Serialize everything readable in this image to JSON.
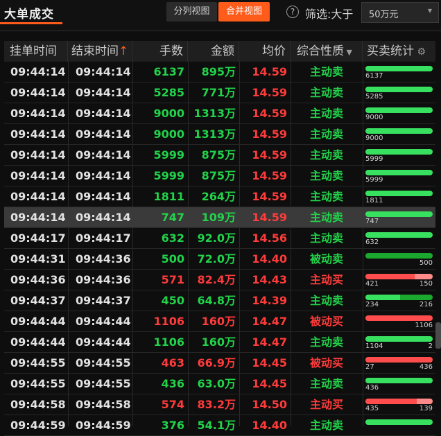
{
  "title": "大单成交",
  "view_toggle": {
    "split": "分列视图",
    "merge": "合并视图"
  },
  "filter": {
    "label": "筛选:大于",
    "value": "50万元"
  },
  "columns": [
    "挂单时间",
    "结束时间",
    "手数",
    "金额",
    "均价",
    "综合性质",
    "买卖统计"
  ],
  "colors": {
    "accent": "#ff5b1a",
    "up": "#ff3b3b",
    "down": "#22d34a",
    "buy_bar": "#38e060",
    "passive_sell_bar": "#1aa82e",
    "sell_bar": "#ff4d4d"
  },
  "rows": [
    {
      "start": "09:44:14",
      "end": "09:44:14",
      "vol": "6137",
      "amt": "895万",
      "avg": "14.59",
      "type": "主动卖",
      "dir": "dn",
      "bar": {
        "kind": "buy",
        "ratio": 1,
        "left": "6137",
        "right": ""
      }
    },
    {
      "start": "09:44:14",
      "end": "09:44:14",
      "vol": "5285",
      "amt": "771万",
      "avg": "14.59",
      "type": "主动卖",
      "dir": "dn",
      "bar": {
        "kind": "buy",
        "ratio": 1,
        "left": "5285",
        "right": ""
      }
    },
    {
      "start": "09:44:14",
      "end": "09:44:14",
      "vol": "9000",
      "amt": "1313万",
      "avg": "14.59",
      "type": "主动卖",
      "dir": "dn",
      "bar": {
        "kind": "buy",
        "ratio": 1,
        "left": "9000",
        "right": ""
      }
    },
    {
      "start": "09:44:14",
      "end": "09:44:14",
      "vol": "9000",
      "amt": "1313万",
      "avg": "14.59",
      "type": "主动卖",
      "dir": "dn",
      "bar": {
        "kind": "buy",
        "ratio": 1,
        "left": "9000",
        "right": ""
      }
    },
    {
      "start": "09:44:14",
      "end": "09:44:14",
      "vol": "5999",
      "amt": "875万",
      "avg": "14.59",
      "type": "主动卖",
      "dir": "dn",
      "bar": {
        "kind": "buy",
        "ratio": 1,
        "left": "5999",
        "right": ""
      }
    },
    {
      "start": "09:44:14",
      "end": "09:44:14",
      "vol": "5999",
      "amt": "875万",
      "avg": "14.59",
      "type": "主动卖",
      "dir": "dn",
      "bar": {
        "kind": "buy",
        "ratio": 1,
        "left": "5999",
        "right": ""
      }
    },
    {
      "start": "09:44:14",
      "end": "09:44:14",
      "vol": "1811",
      "amt": "264万",
      "avg": "14.59",
      "type": "主动卖",
      "dir": "dn",
      "bar": {
        "kind": "buy",
        "ratio": 1,
        "left": "1811",
        "right": ""
      }
    },
    {
      "start": "09:44:14",
      "end": "09:44:14",
      "vol": "747",
      "amt": "109万",
      "avg": "14.59",
      "type": "主动卖",
      "dir": "dn",
      "selected": true,
      "bar": {
        "kind": "buy",
        "ratio": 1,
        "left": "747",
        "right": ""
      }
    },
    {
      "start": "09:44:17",
      "end": "09:44:17",
      "vol": "632",
      "amt": "92.0万",
      "avg": "14.56",
      "type": "主动卖",
      "dir": "dn",
      "bar": {
        "kind": "buy",
        "ratio": 1,
        "left": "632",
        "right": ""
      }
    },
    {
      "start": "09:44:31",
      "end": "09:44:36",
      "vol": "500",
      "amt": "72.0万",
      "avg": "14.40",
      "type": "被动卖",
      "dir": "dn",
      "bar": {
        "kind": "passive",
        "ratio": 1,
        "left": "",
        "right": "500"
      }
    },
    {
      "start": "09:44:36",
      "end": "09:44:36",
      "vol": "571",
      "amt": "82.4万",
      "avg": "14.43",
      "type": "主动买",
      "dir": "up",
      "bar": {
        "kind": "mixed",
        "ratio": 0.737,
        "left": "421",
        "right": "150"
      }
    },
    {
      "start": "09:44:37",
      "end": "09:44:37",
      "vol": "450",
      "amt": "64.8万",
      "avg": "14.39",
      "type": "主动卖",
      "dir": "dn",
      "bar": {
        "kind": "split",
        "ratio": 0.52,
        "left": "234",
        "right": "216"
      }
    },
    {
      "start": "09:44:44",
      "end": "09:44:44",
      "vol": "1106",
      "amt": "160万",
      "avg": "14.47",
      "type": "被动买",
      "dir": "up",
      "bar": {
        "kind": "sell",
        "ratio": 1,
        "left": "",
        "right": "1106"
      }
    },
    {
      "start": "09:44:44",
      "end": "09:44:44",
      "vol": "1106",
      "amt": "160万",
      "avg": "14.47",
      "type": "主动卖",
      "dir": "dn",
      "bar": {
        "kind": "buy",
        "ratio": 0.998,
        "left": "1104",
        "right": "2"
      }
    },
    {
      "start": "09:44:55",
      "end": "09:44:55",
      "vol": "463",
      "amt": "66.9万",
      "avg": "14.45",
      "type": "被动买",
      "dir": "up",
      "bar": {
        "kind": "sell",
        "ratio": 1,
        "left": "27",
        "right": "436"
      }
    },
    {
      "start": "09:44:55",
      "end": "09:44:55",
      "vol": "436",
      "amt": "63.0万",
      "avg": "14.45",
      "type": "主动卖",
      "dir": "dn",
      "bar": {
        "kind": "buy",
        "ratio": 1,
        "left": "436",
        "right": ""
      }
    },
    {
      "start": "09:44:58",
      "end": "09:44:58",
      "vol": "574",
      "amt": "83.2万",
      "avg": "14.50",
      "type": "主动买",
      "dir": "up",
      "bar": {
        "kind": "mixed",
        "ratio": 0.758,
        "left": "435",
        "right": "139"
      }
    },
    {
      "start": "09:44:59",
      "end": "09:44:59",
      "vol": "376",
      "amt": "54.1万",
      "avg": "14.40",
      "type": "主动卖",
      "dir": "dn",
      "bar": {
        "kind": "buy",
        "ratio": 1,
        "left": "",
        "right": ""
      }
    }
  ]
}
